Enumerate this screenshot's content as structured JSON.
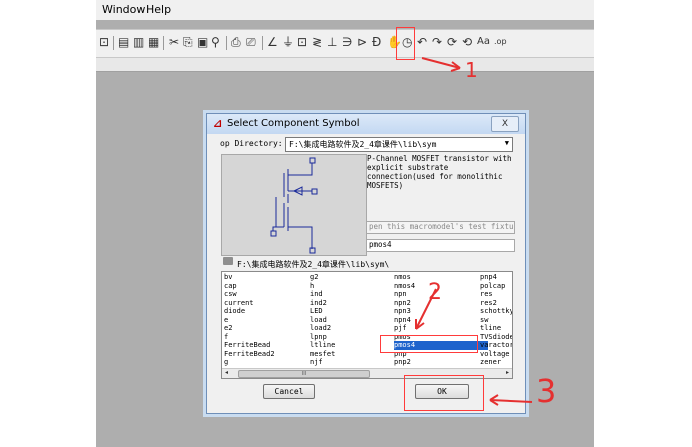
{
  "menu": {
    "window": "Window",
    "help": "Help"
  },
  "toolbar": {
    "icons": [
      "open-icon",
      "component-icon",
      "capacitor-icon",
      "cut-icon",
      "copy-icon",
      "paste-icon",
      "find-icon",
      "print-icon",
      "print-preview-icon",
      "wire-icon",
      "ground-icon",
      "label-icon",
      "resistor-icon",
      "capacitor-symbol-icon",
      "inductor-icon",
      "diode-icon",
      "component-symbol-icon",
      "drag-icon",
      "move-icon",
      "undo-icon",
      "redo-icon",
      "rotate-icon",
      "mirror-icon",
      "text-icon",
      "spice-directive-icon"
    ],
    "text_label": "Aa",
    "op_label": ".op"
  },
  "annotations": {
    "one": "1",
    "two": "2",
    "three": "3"
  },
  "dialog": {
    "title": "Select Component Symbol",
    "close": "X",
    "directory_label": "op Directory:",
    "directory_value": "F:\\集成电路软件及2_4章课件\\lib\\sym",
    "description": "P-Channel MOSFET transistor with explicit substrate connection(used for monolithic MOSFETS)",
    "test_fixture": "pen this macromodel's test fixtur",
    "selected_name": "pmos4",
    "path": "F:\\集成电路软件及2_4章课件\\lib\\sym\\",
    "columns": [
      [
        "bv",
        "cap",
        "csw",
        "current",
        "diode",
        "e",
        "e2",
        "f",
        "FerriteBead",
        "FerriteBead2",
        "g"
      ],
      [
        "g2",
        "h",
        "ind",
        "ind2",
        "LED",
        "load",
        "load2",
        "lpnp",
        "ltline",
        "mesfet",
        "njf"
      ],
      [
        "nmos",
        "nmos4",
        "npn",
        "npn2",
        "npn3",
        "npn4",
        "pjf",
        "pmos",
        "pmos4",
        "pnp",
        "pnp2"
      ],
      [
        "pnp4",
        "polcap",
        "res",
        "res2",
        "schottky",
        "sw",
        "tline",
        "TVSdiode",
        "varactor",
        "voltage",
        "zener"
      ]
    ],
    "selected_item": "pmos4",
    "scroll_thumb": "III",
    "cancel": "Cancel",
    "ok": "OK"
  }
}
